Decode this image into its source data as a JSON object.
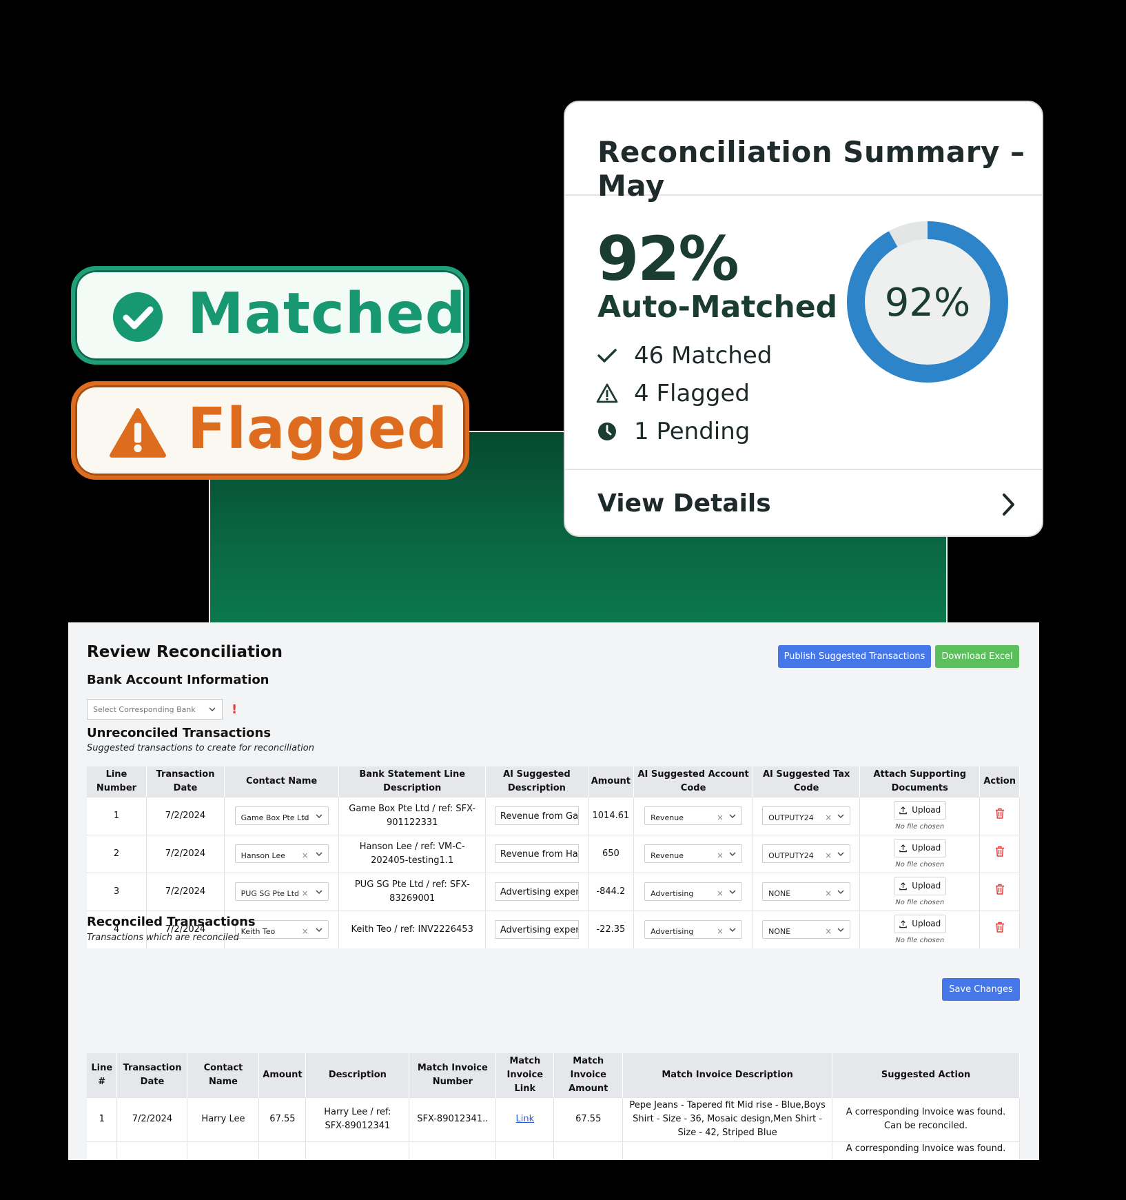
{
  "badges": {
    "matched_label": "Matched",
    "flagged_label": "Flagged"
  },
  "summary": {
    "title": "Reconciliation Summary – May",
    "percent": "92%",
    "percent_value": 0.92,
    "subtitle": "Auto-Matched",
    "stats": [
      {
        "icon": "check-icon",
        "label": "46 Matched"
      },
      {
        "icon": "warning-icon",
        "label": "4 Flagged"
      },
      {
        "icon": "clock-icon",
        "label": "1 Pending"
      }
    ],
    "donut_label": "92%",
    "footer_label": "View Details"
  },
  "colors": {
    "green": "#179870",
    "orange": "#dd6c1e",
    "donut_blue": "#2d84c9",
    "primary_button": "#4577e8",
    "success_button": "#5bbf5b",
    "danger": "#e53935"
  },
  "app": {
    "title": "Review Reconciliation",
    "publish_button": "Publish Suggested Transactions",
    "download_button": "Download Excel",
    "bank_section_title": "Bank Account Information",
    "bank_select_placeholder": "Select Corresponding Bank",
    "bank_warning": "!",
    "unreconciled": {
      "title": "Unreconciled Transactions",
      "subtitle": "Suggested transactions to create for reconciliation",
      "headers": [
        "Line Number",
        "Transaction Date",
        "Contact Name",
        "Bank Statement Line Description",
        "AI Suggested Description",
        "Amount",
        "AI Suggested Account Code",
        "AI Suggested Tax Code",
        "Attach Supporting Documents",
        "Action"
      ],
      "upload_label": "Upload",
      "no_file_label": "No file chosen",
      "rows": [
        {
          "line": "1",
          "date": "7/2/2024",
          "contact": "Game Box Pte Ltd",
          "bank_desc": "Game Box Pte Ltd / ref: SFX-901122331",
          "ai_desc": "Revenue from Game",
          "amount": "1014.61",
          "account": "Revenue",
          "tax": "OUTPUTY24"
        },
        {
          "line": "2",
          "date": "7/2/2024",
          "contact": "Hanson Lee",
          "bank_desc": "Hanson Lee / ref: VM-C-202405-testing1.1",
          "ai_desc": "Revenue from Hanso",
          "amount": "650",
          "account": "Revenue",
          "tax": "OUTPUTY24"
        },
        {
          "line": "3",
          "date": "7/2/2024",
          "contact": "PUG SG Pte Ltd",
          "bank_desc": "PUG SG Pte Ltd / ref: SFX-83269001",
          "ai_desc": "Advertising expense",
          "amount": "-844.2",
          "account": "Advertising",
          "tax": "NONE"
        },
        {
          "line": "4",
          "date": "7/2/2024",
          "contact": "Keith Teo",
          "bank_desc": "Keith Teo / ref: INV2226453",
          "ai_desc": "Advertising expense",
          "amount": "-22.35",
          "account": "Advertising",
          "tax": "NONE"
        }
      ],
      "save_button": "Save Changes"
    },
    "reconciled": {
      "title": "Reconciled Transactions",
      "subtitle": "Transactions which are reconciled",
      "headers": [
        "Line #",
        "Transaction Date",
        "Contact Name",
        "Amount",
        "Description",
        "Match Invoice Number",
        "Match Invoice Link",
        "Match Invoice Amount",
        "Match Invoice Description",
        "Suggested Action"
      ],
      "rows": [
        {
          "line": "1",
          "date": "7/2/2024",
          "contact": "Harry Lee",
          "amount": "67.55",
          "description": "Harry Lee / ref: SFX-89012341",
          "invoice_number": "SFX-89012341..",
          "link": "Link",
          "invoice_amount": "67.55",
          "invoice_description": "Pepe Jeans - Tapered fit Mid rise - Blue,Boys Shirt - Size - 36, Mosaic design,Men Shirt - Size - 42, Striped Blue",
          "suggested_action": "A corresponding Invoice was found. Can be reconciled."
        },
        {
          "line": "",
          "date": "",
          "contact": "",
          "amount": "",
          "description": "",
          "invoice_number": "",
          "link": "",
          "invoice_amount": "",
          "invoice_description": "",
          "suggested_action": "A corresponding Invoice was found."
        }
      ]
    }
  }
}
